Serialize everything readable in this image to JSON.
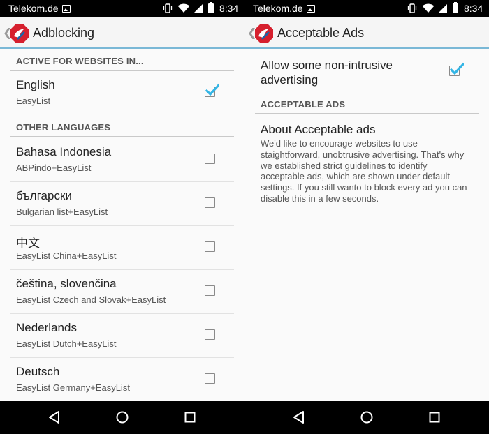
{
  "status_bar": {
    "carrier": "Telekom.de",
    "time": "8:34",
    "icons": [
      "image-notification-icon",
      "vibrate-icon",
      "wifi-icon",
      "signal-icon",
      "battery-icon"
    ]
  },
  "left_screen": {
    "title": "Adblocking",
    "active_category": "ACTIVE FOR WEBSITES IN...",
    "active_items": [
      {
        "title": "English",
        "summary": "EasyList",
        "checked": true
      }
    ],
    "other_category": "OTHER LANGUAGES",
    "other_items": [
      {
        "title": "Bahasa Indonesia",
        "summary": "ABPindo+EasyList",
        "checked": false
      },
      {
        "title": "български",
        "summary": "Bulgarian list+EasyList",
        "checked": false
      },
      {
        "title": "中文",
        "summary": "EasyList China+EasyList",
        "checked": false
      },
      {
        "title": "čeština, slovenčina",
        "summary": "EasyList Czech and Slovak+EasyList",
        "checked": false
      },
      {
        "title": "Nederlands",
        "summary": "EasyList Dutch+EasyList",
        "checked": false
      },
      {
        "title": "Deutsch",
        "summary": "EasyList Germany+EasyList",
        "checked": false
      }
    ]
  },
  "right_screen": {
    "title": "Acceptable Ads",
    "allow_label": "Allow some non-intrusive advertising",
    "allow_checked": true,
    "category": "ACCEPTABLE ADS",
    "about_title": "About Acceptable ads",
    "about_text": "We'd like to encourage websites to use staightforward, unobtrusive advertising. That's why we established strict guidelines to identify acceptable ads, which are shown under default settings. If you still wanto to block every ad you can disable this in a few seconds."
  },
  "colors": {
    "accent": "#33b5e5",
    "actionbar_divider": "#7ab8d6",
    "logo_red": "#d6202e"
  }
}
